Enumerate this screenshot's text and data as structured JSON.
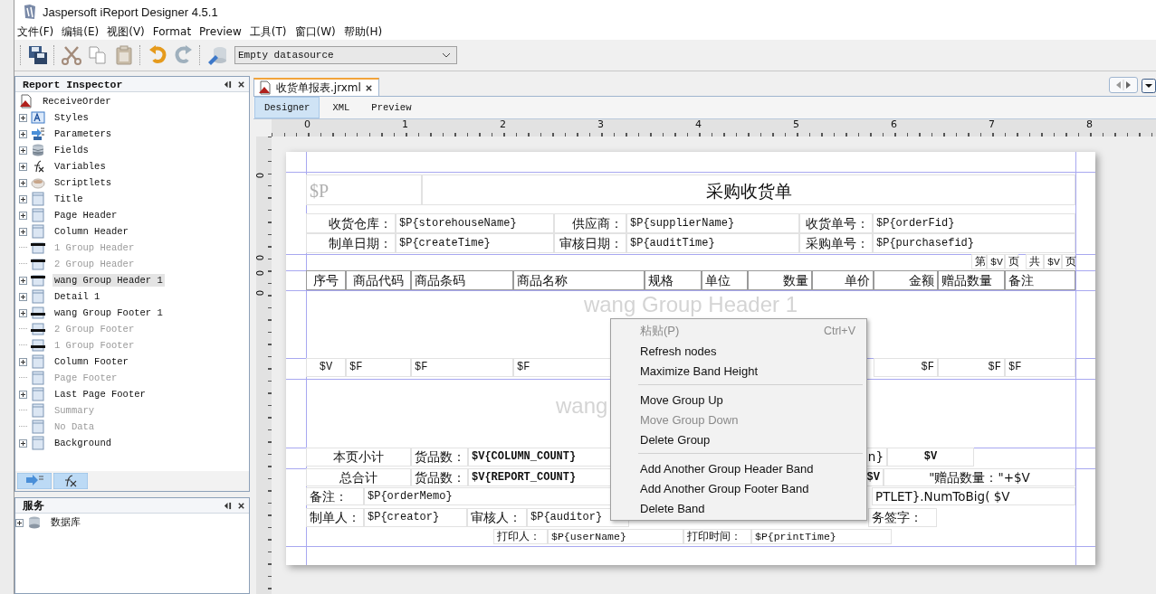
{
  "window": {
    "title": "Jaspersoft iReport Designer 4.5.1"
  },
  "menu_bar": [
    "文件(F)",
    "编辑(E)",
    "视图(V)",
    "Format",
    "Preview",
    "工具(T)",
    "窗口(W)",
    "帮助(H)"
  ],
  "toolbar": {
    "datasource": "Empty datasource"
  },
  "report_inspector": {
    "title": "Report Inspector",
    "tree": {
      "label": "ReceiveOrder",
      "kind": "report",
      "children": [
        {
          "label": "Styles",
          "kind": "styles",
          "expandable": true,
          "disabled": false,
          "selected": false
        },
        {
          "label": "Parameters",
          "kind": "parameters",
          "expandable": true,
          "disabled": false,
          "selected": false
        },
        {
          "label": "Fields",
          "kind": "fields",
          "expandable": true,
          "disabled": false,
          "selected": false
        },
        {
          "label": "Variables",
          "kind": "variables",
          "expandable": true,
          "disabled": false,
          "selected": false
        },
        {
          "label": "Scriptlets",
          "kind": "scriptlets",
          "expandable": true,
          "disabled": false,
          "selected": false
        },
        {
          "label": "Title",
          "kind": "band",
          "expandable": true,
          "disabled": false,
          "selected": false
        },
        {
          "label": "Page Header",
          "kind": "band",
          "expandable": true,
          "disabled": false,
          "selected": false
        },
        {
          "label": "Column Header",
          "kind": "band",
          "expandable": true,
          "disabled": false,
          "selected": false
        },
        {
          "label": "1 Group Header",
          "kind": "groupheader",
          "expandable": false,
          "disabled": true,
          "selected": false
        },
        {
          "label": "2 Group Header",
          "kind": "groupheader",
          "expandable": false,
          "disabled": true,
          "selected": false
        },
        {
          "label": "wang Group Header 1",
          "kind": "groupheader",
          "expandable": true,
          "disabled": false,
          "selected": true
        },
        {
          "label": "Detail 1",
          "kind": "band",
          "expandable": true,
          "disabled": false,
          "selected": false
        },
        {
          "label": "wang Group Footer 1",
          "kind": "groupfooter",
          "expandable": true,
          "disabled": false,
          "selected": false
        },
        {
          "label": "2 Group Footer",
          "kind": "groupfooter",
          "expandable": false,
          "disabled": true,
          "selected": false
        },
        {
          "label": "1 Group Footer",
          "kind": "groupfooter",
          "expandable": false,
          "disabled": true,
          "selected": false
        },
        {
          "label": "Column Footer",
          "kind": "band",
          "expandable": true,
          "disabled": false,
          "selected": false
        },
        {
          "label": "Page Footer",
          "kind": "band",
          "expandable": false,
          "disabled": true,
          "selected": false
        },
        {
          "label": "Last Page Footer",
          "kind": "band",
          "expandable": true,
          "disabled": false,
          "selected": false
        },
        {
          "label": "Summary",
          "kind": "band",
          "expandable": false,
          "disabled": true,
          "selected": false
        },
        {
          "label": "No Data",
          "kind": "band",
          "expandable": false,
          "disabled": true,
          "selected": false
        },
        {
          "label": "Background",
          "kind": "band",
          "expandable": true,
          "disabled": false,
          "selected": false
        }
      ]
    }
  },
  "services": {
    "title": "服务",
    "tree": [
      {
        "label": "数据库",
        "expandable": true
      }
    ]
  },
  "editor": {
    "tab": "收货单报表.jrxml",
    "views": [
      {
        "label": "Designer",
        "selected": true
      },
      {
        "label": "XML",
        "selected": false
      },
      {
        "label": "Preview",
        "selected": false
      }
    ],
    "ruler_labels": [
      "0",
      "1",
      "2",
      "3",
      "4",
      "5",
      "6",
      "7",
      "8"
    ],
    "vertical_ruler_labels": [
      "0",
      "0",
      "0",
      "0"
    ]
  },
  "report": {
    "band_labels": [
      "wang Group Header 1",
      "wang"
    ],
    "title": {
      "image_expression": "$P",
      "text": "采购收货单"
    },
    "info_rows": [
      [
        "收货仓库：",
        "$P{storehouseName}",
        "供应商：",
        "$P{supplierName}",
        "收货单号：",
        "$P{orderFid}"
      ],
      [
        "制单日期：",
        "$P{createTime}",
        "审核日期：",
        "$P{auditTime}",
        "采购单号：",
        "$P{purchasefid}"
      ]
    ],
    "page_number": [
      "第",
      "$V",
      "页",
      "共",
      "$V",
      "页"
    ],
    "column_headers": [
      "序号",
      "商品代码",
      "商品条码",
      "商品名称",
      "规格",
      "单位",
      "数量",
      "单价",
      "金额",
      "赠品数量",
      "备注"
    ],
    "detail": [
      "$V",
      "$F",
      "$F",
      "$F",
      "$F",
      "$F",
      "$F"
    ],
    "column_footer": [
      [
        "本页小计",
        "货品数：",
        "$V{COLUMN_COUNT}",
        "n}",
        "$V"
      ],
      [
        "总合计",
        "货品数：",
        "$V{REPORT_COUNT}",
        "$V",
        "\"赠品数量：\"+$V"
      ]
    ],
    "memo": [
      "备注：",
      "$P{orderMemo}",
      "PTLET}.NumToBig( $V"
    ],
    "signatures": [
      "制单人：",
      "$P{creator}",
      "审核人：",
      "$P{auditor}",
      "务签字："
    ],
    "print_info": [
      "打印人：",
      "$P{userName}",
      "打印时间：",
      "$P{printTime}"
    ]
  },
  "context_menu": [
    {
      "kind": "item",
      "label": "粘贴(P)",
      "shortcut": "Ctrl+V",
      "disabled": true
    },
    {
      "kind": "item",
      "label": "Refresh nodes",
      "disabled": false
    },
    {
      "kind": "item",
      "label": "Maximize Band Height",
      "disabled": false
    },
    {
      "kind": "separator"
    },
    {
      "kind": "item",
      "label": "Move Group Up",
      "disabled": false
    },
    {
      "kind": "item",
      "label": "Move Group Down",
      "disabled": true
    },
    {
      "kind": "item",
      "label": "Delete Group",
      "disabled": false
    },
    {
      "kind": "separator"
    },
    {
      "kind": "item",
      "label": "Add Another Group Header Band",
      "disabled": false
    },
    {
      "kind": "item",
      "label": "Add Another Group Footer Band",
      "disabled": false
    },
    {
      "kind": "item",
      "label": "Delete Band",
      "disabled": false
    }
  ]
}
